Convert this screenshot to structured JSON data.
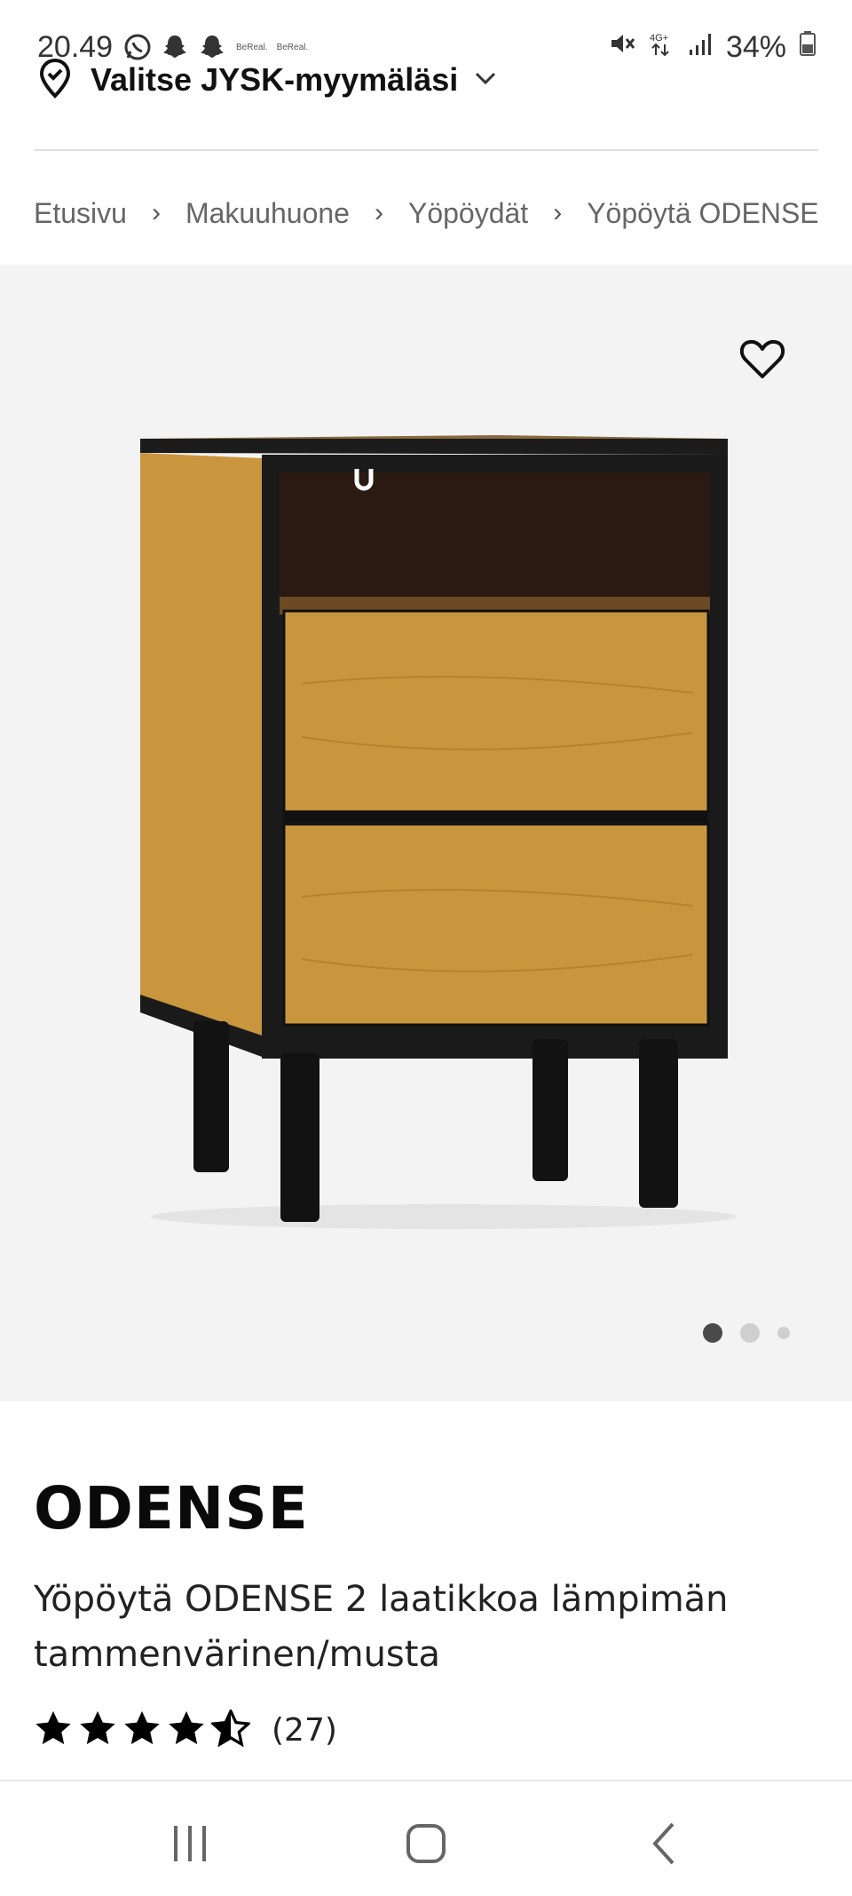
{
  "status_bar": {
    "time": "20.49",
    "small_labels": [
      "BeReal.",
      "BeReal."
    ],
    "battery": "34%"
  },
  "store": {
    "label": "Valitse JYSK-myymäläsi"
  },
  "breadcrumb": [
    "Etusivu",
    "Makuuhuone",
    "Yöpöydät",
    "Yöpöytä ODENSE"
  ],
  "gallery": {
    "image_count": 3,
    "active_index": 0
  },
  "product": {
    "title": "ODENSE",
    "subtitle": "Yöpöytä ODENSE 2 laatikkoa lämpimän tammenvärinen/musta",
    "rating": 4.5,
    "review_count": "(27)"
  },
  "colors": {
    "gallery_bg": "#f3f3f3",
    "oak": "#c9963e",
    "black": "#1a1a1a",
    "dot_active": "#4a4a4a",
    "dot_inactive": "#cfcfcf"
  }
}
